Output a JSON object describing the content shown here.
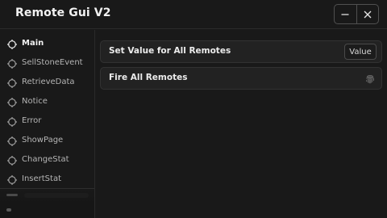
{
  "window": {
    "title": "Remote Gui V2",
    "minimize_icon": "minus-icon",
    "close_icon": "close-icon"
  },
  "sidebar": {
    "items": [
      {
        "label": "Main",
        "icon": "crosshair-icon",
        "active": true
      },
      {
        "label": "SellStoneEvent",
        "icon": "crosshair-icon",
        "active": false
      },
      {
        "label": "RetrieveData",
        "icon": "crosshair-icon",
        "active": false
      },
      {
        "label": "Notice",
        "icon": "crosshair-icon",
        "active": false
      },
      {
        "label": "Error",
        "icon": "crosshair-icon",
        "active": false
      },
      {
        "label": "ShowPage",
        "icon": "crosshair-icon",
        "active": false
      },
      {
        "label": "ChangeStat",
        "icon": "crosshair-icon",
        "active": false
      },
      {
        "label": "InsertStat",
        "icon": "crosshair-icon",
        "active": false
      }
    ]
  },
  "main": {
    "set_value_row": {
      "label": "Set Value for All Remotes",
      "input_placeholder": "Value"
    },
    "fire_row": {
      "label": "Fire All Remotes",
      "icon": "fingerprint-icon"
    }
  },
  "colors": {
    "background": "#191919",
    "row_background": "#222222",
    "border": "#323232",
    "text": "#ececec",
    "muted_text": "#b4b4b4"
  }
}
